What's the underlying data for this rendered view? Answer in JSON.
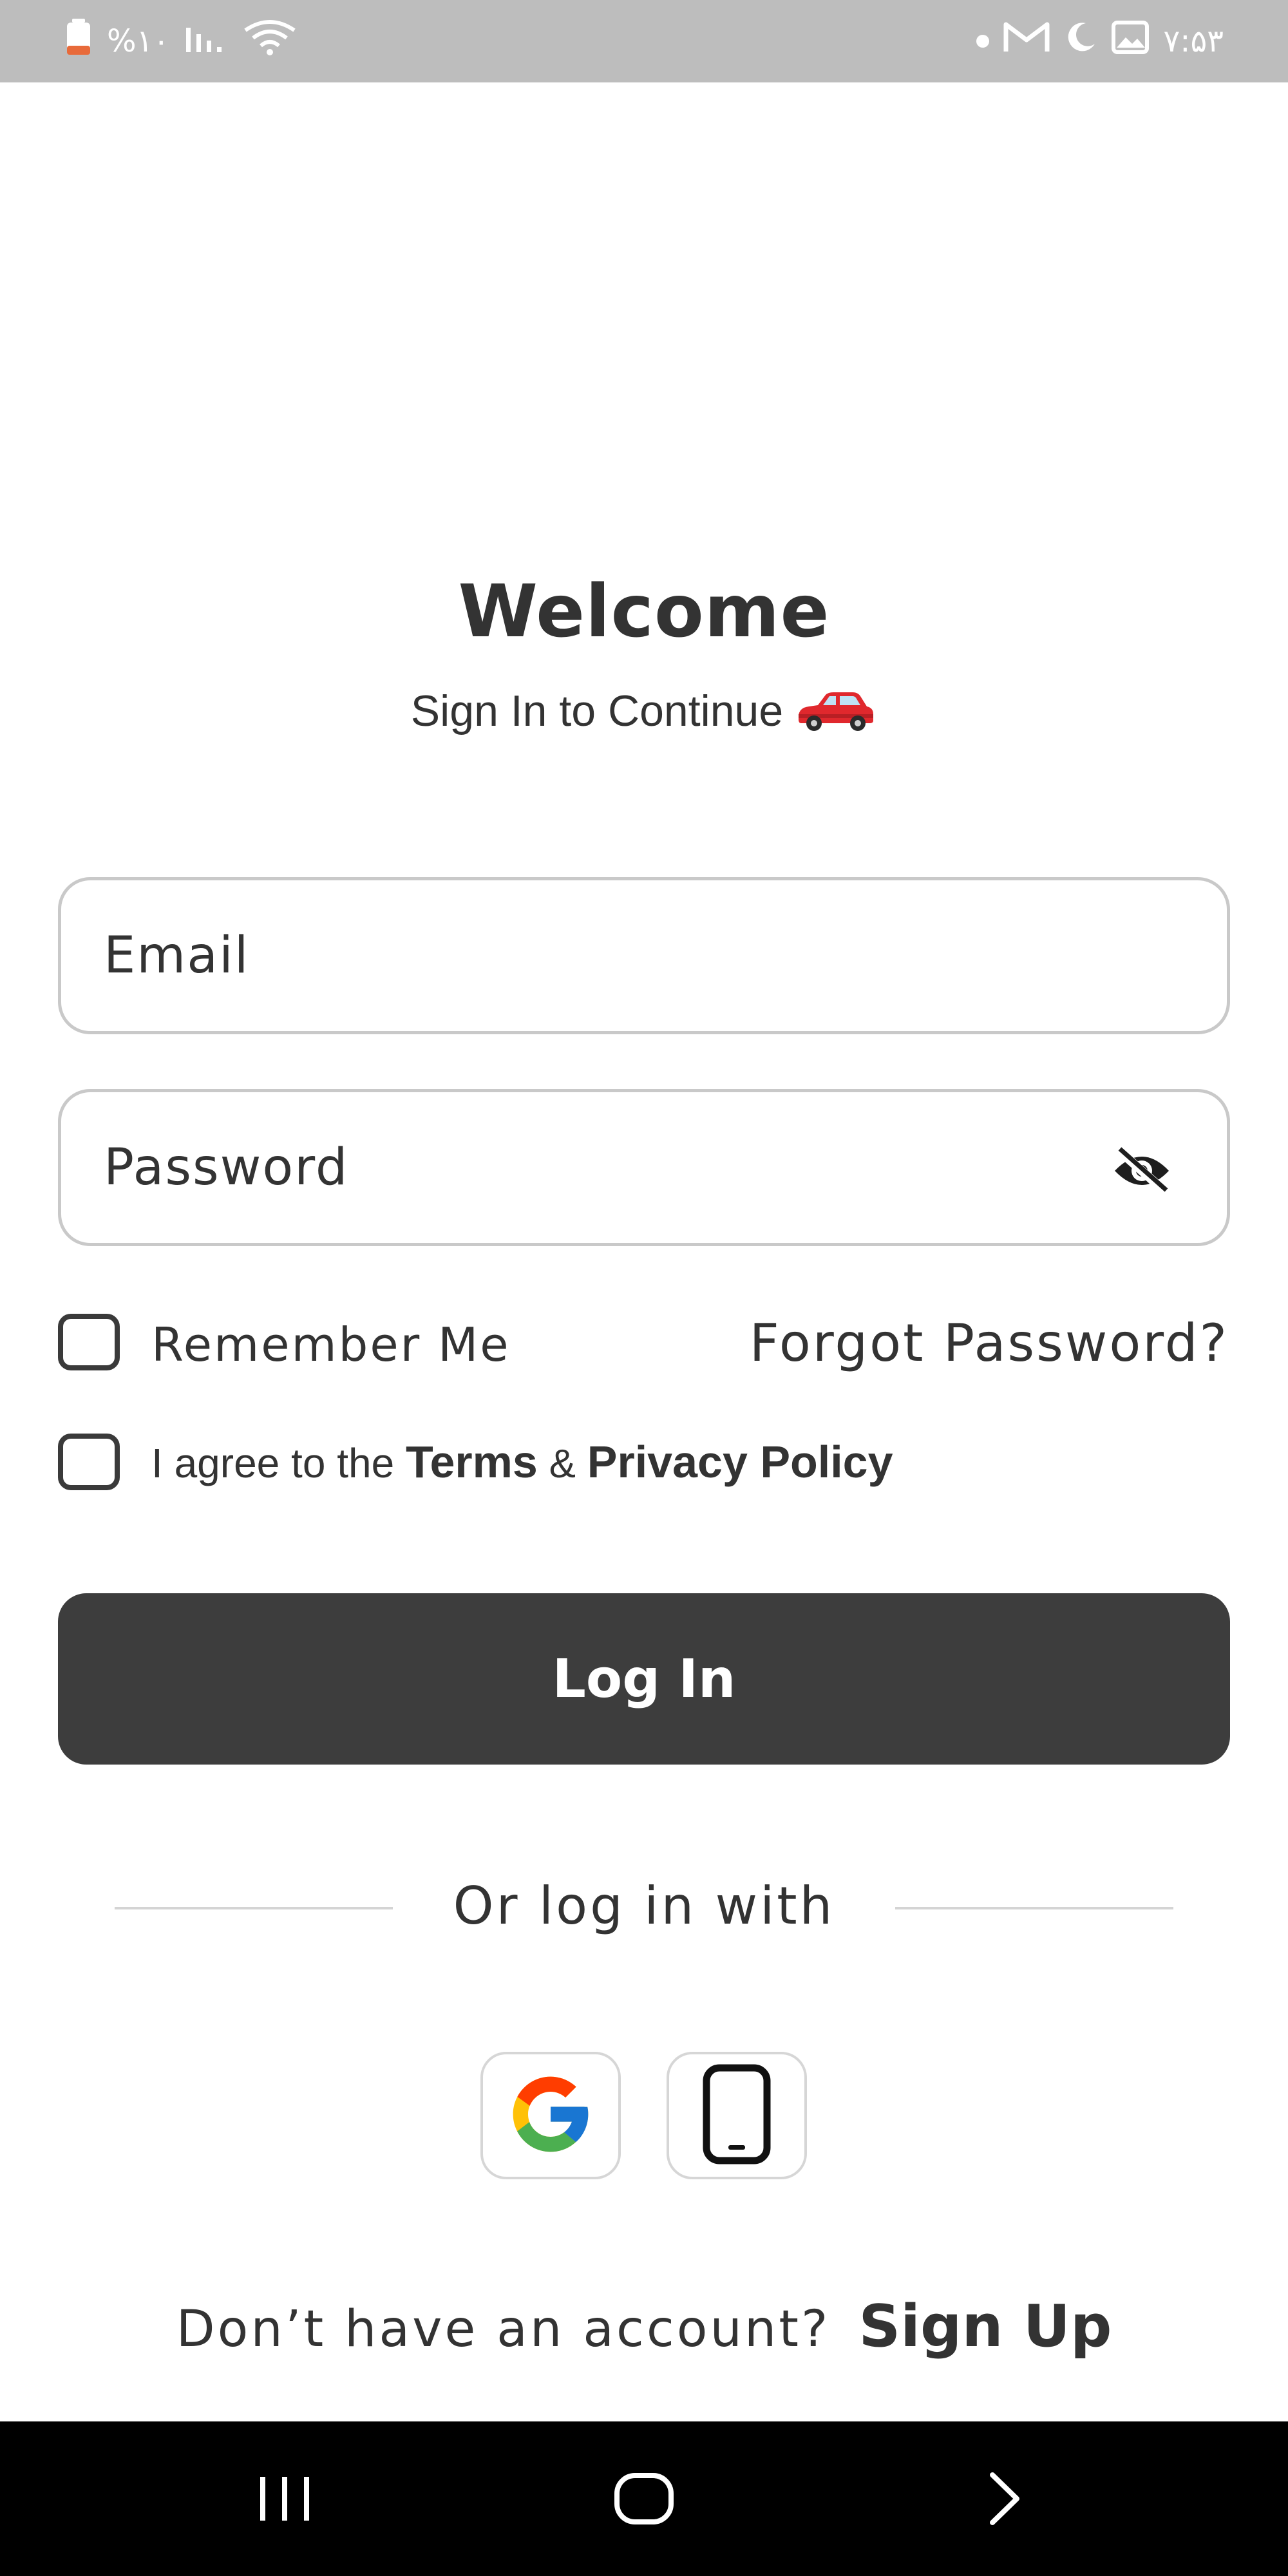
{
  "status_bar": {
    "battery": "%۱۰",
    "time": "۷:۵۳"
  },
  "header": {
    "title": "Welcome",
    "subtitle": "Sign In to Continue",
    "subtitle_icon": "car-icon"
  },
  "form": {
    "email_placeholder": "Email",
    "password_placeholder": "Password",
    "password_toggle_icon": "eye-off-icon",
    "remember_label": "Remember Me",
    "remember_checked": false,
    "forgot_label": "Forgot Password?",
    "agree_prefix": "I agree to the",
    "terms_label": "Terms",
    "amp": "&",
    "privacy_label": "Privacy Policy",
    "agree_checked": false,
    "login_label": "Log In"
  },
  "divider": {
    "label": "Or log in with"
  },
  "social": {
    "google_icon": "google-icon",
    "phone_icon": "phone-icon"
  },
  "footer": {
    "prompt": "Don’t have an account?",
    "signup_label": "Sign Up"
  },
  "colors": {
    "status_bar_bg": "#bdbdbd",
    "text": "#333333",
    "button_bg": "#3d3d3d",
    "input_border": "#c9c9c9",
    "nav_bar_bg": "#000000",
    "battery_low": "#e86a3a"
  }
}
